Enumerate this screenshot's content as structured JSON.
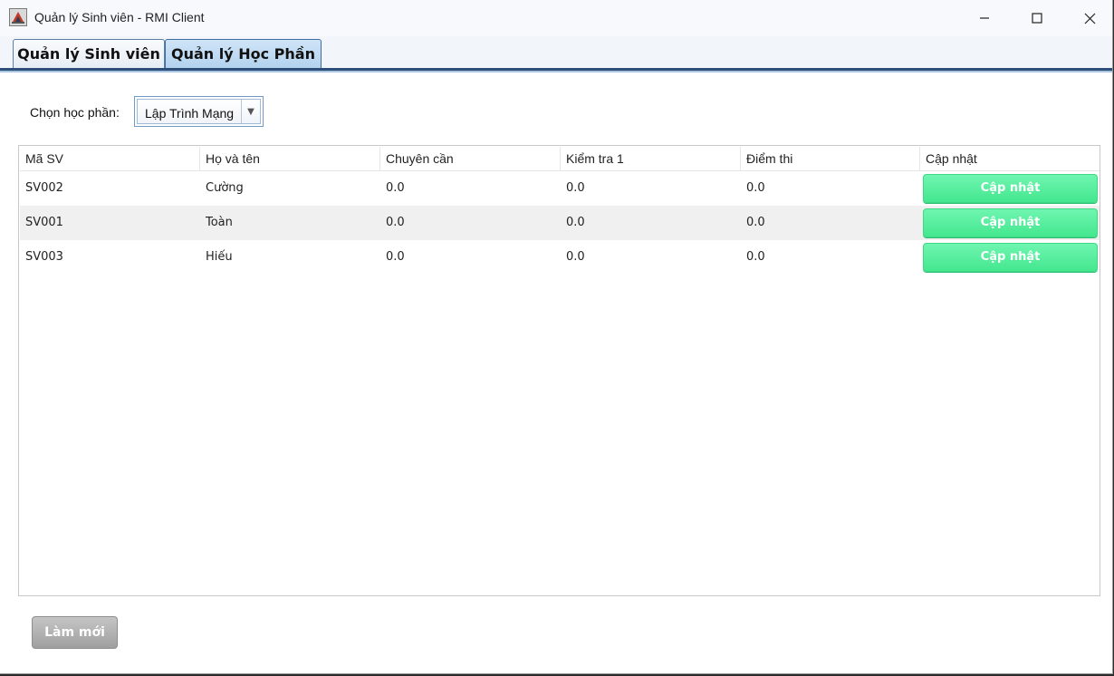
{
  "window": {
    "title": "Quản lý Sinh viên - RMI Client"
  },
  "tabs": [
    {
      "label": "Quản lý Sinh viên",
      "selected": false
    },
    {
      "label": "Quản lý Học Phần",
      "selected": true
    }
  ],
  "course_picker": {
    "label": "Chọn học phần:",
    "selected": "Lập Trình Mạng"
  },
  "table": {
    "columns": [
      "Mã SV",
      "Họ và tên",
      "Chuyên cần",
      "Kiểm tra 1",
      "Điểm thi",
      "Cập nhật"
    ],
    "rows": [
      {
        "id": "SV002",
        "name": "Cường",
        "attendance": "0.0",
        "test1": "0.0",
        "exam": "0.0",
        "action": "Cập nhật"
      },
      {
        "id": "SV001",
        "name": "Toàn",
        "attendance": "0.0",
        "test1": "0.0",
        "exam": "0.0",
        "action": "Cập nhật"
      },
      {
        "id": "SV003",
        "name": "Hiếu",
        "attendance": "0.0",
        "test1": "0.0",
        "exam": "0.0",
        "action": "Cập nhật"
      }
    ]
  },
  "footer": {
    "refresh_label": "Làm mới"
  },
  "colors": {
    "update_button": "#4fec99",
    "refresh_button": "#b0b0b0",
    "tab_selected": "#bcd8f1",
    "tab_border": "#2d4f7a"
  }
}
